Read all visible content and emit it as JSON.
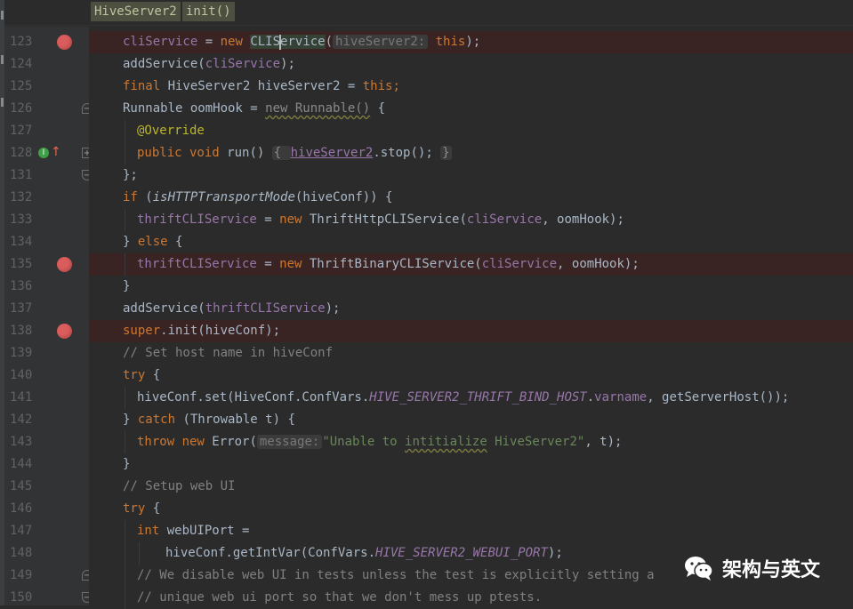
{
  "breadcrumb": {
    "class_name": "HiveServer2",
    "method_name": "init()"
  },
  "lines": [
    {
      "n": "123",
      "bp": true
    },
    {
      "n": "124"
    },
    {
      "n": "125"
    },
    {
      "n": "126",
      "fold": "start"
    },
    {
      "n": "127"
    },
    {
      "n": "128",
      "impl": true,
      "fold": "plus"
    },
    {
      "n": "131",
      "fold": "end"
    },
    {
      "n": "132"
    },
    {
      "n": "133"
    },
    {
      "n": "134"
    },
    {
      "n": "135",
      "bp": true
    },
    {
      "n": "136"
    },
    {
      "n": "137"
    },
    {
      "n": "138",
      "bp": true
    },
    {
      "n": "139"
    },
    {
      "n": "140"
    },
    {
      "n": "141"
    },
    {
      "n": "142"
    },
    {
      "n": "143"
    },
    {
      "n": "144"
    },
    {
      "n": "145"
    },
    {
      "n": "146"
    },
    {
      "n": "147"
    },
    {
      "n": "148"
    },
    {
      "n": "149",
      "fold": "start"
    },
    {
      "n": "150",
      "fold": "end"
    }
  ],
  "code": {
    "l123": {
      "a": "cliService",
      " eq": " = ",
      "new": "new ",
      "cls1": "CLIS",
      "cls2": "ervice",
      "p": "(",
      "hint": "hiveServer2:",
      "this": " this",
      "end": ");"
    },
    "l124": {
      "a": "addService(",
      "b": "cliService",
      "c": ");"
    },
    "l125": {
      "a": "final ",
      "b": "HiveServer2 hiveServer2 = ",
      "c": "this",
      ";": ";"
    },
    "l126": {
      "a": "Runnable oomHook = ",
      "b": "new Runnable()",
      "c": " {"
    },
    "l127": {
      "a": "@Override"
    },
    "l128": {
      "a": "public void ",
      "b": "run() ",
      "c": "{ ",
      "d": "hiveServer2",
      ".": ".stop(); ",
      "e": "}"
    },
    "l131": {
      "a": "};"
    },
    "l132": {
      "a": "if ",
      "b": "(",
      "c": "isHTTPTransportMode",
      "d": "(hiveConf)) {"
    },
    "l133": {
      "a": "thriftCLIService",
      " ": " = ",
      "new": "new ",
      "b": "ThriftHttpCLIService(",
      "c": "cliService",
      ", ": ", oomHook);"
    },
    "l134": {
      "a": "} ",
      "b": "else",
      " ": " {"
    },
    "l135": {
      "a": "thriftCLIService",
      " ": " = ",
      "new": "new ",
      "b": "ThriftBinaryCLIService(",
      "c": "cliService",
      ", ": ", oomHook);"
    },
    "l136": {
      "a": "}"
    },
    "l137": {
      "a": "addService(",
      "b": "thriftCLIService",
      "c": ");"
    },
    "l138": {
      "a": "super",
      ".": ".init(hiveConf);"
    },
    "l139": {
      "a": "// Set host name in hiveConf"
    },
    "l140": {
      "a": "try",
      " ": " {"
    },
    "l141": {
      "a": "hiveConf.set(HiveConf.ConfVars.",
      "b": "HIVE_SERVER2_THRIFT_BIND_HOST",
      ".": ".",
      "c": "varname",
      ", ": ", getServerHost());"
    },
    "l142": {
      "a": "} ",
      "b": "catch",
      " ": " (Throwable t) {"
    },
    "l143": {
      "a": "throw new ",
      "b": "Error(",
      "hint": "message:",
      "str1": "\"Unable to ",
      "str2": "intitialize",
      "str3": " HiveServer2\"",
      ", ": ", t);"
    },
    "l144": {
      "a": "}"
    },
    "l145": {
      "a": "// Setup web UI"
    },
    "l146": {
      "a": "try",
      " ": " {"
    },
    "l147": {
      "a": "int ",
      "b": "webUIPort ="
    },
    "l148": {
      "a": "hiveConf.getIntVar(ConfVars.",
      "b": "HIVE_SERVER2_WEBUI_PORT",
      ");": ");"
    },
    "l149": {
      "a": "// We disable web UI in tests unless the test is explicitly setting a"
    },
    "l150": {
      "a": "// unique web ui port so that we don't mess up ptests."
    }
  },
  "watermark": {
    "text": "架构与英文",
    "icon": "wechat-icon"
  }
}
